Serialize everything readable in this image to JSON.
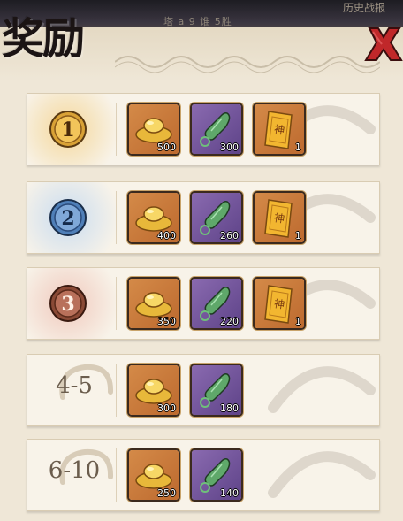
{
  "header": {
    "title": "奖励",
    "background_text": "塔 a 9 谁 5胜",
    "corner_text": "历史战报"
  },
  "rows": [
    {
      "rank": "1",
      "medal_color": "#d9a236",
      "glow": "#f4d79a",
      "rewards": [
        {
          "type": "gold-ingot",
          "qty": "500"
        },
        {
          "type": "jade-token",
          "qty": "300"
        },
        {
          "type": "talisman-card",
          "qty": "1"
        }
      ]
    },
    {
      "rank": "2",
      "medal_color": "#4f7fb8",
      "glow": "#c9dcf0",
      "rewards": [
        {
          "type": "gold-ingot",
          "qty": "400"
        },
        {
          "type": "jade-token",
          "qty": "260"
        },
        {
          "type": "talisman-card",
          "qty": "1"
        }
      ]
    },
    {
      "rank": "3",
      "medal_color": "#8a4a36",
      "glow": "#f0c9bd",
      "rewards": [
        {
          "type": "gold-ingot",
          "qty": "350"
        },
        {
          "type": "jade-token",
          "qty": "220"
        },
        {
          "type": "talisman-card",
          "qty": "1"
        }
      ]
    },
    {
      "rank": "4-5",
      "rewards": [
        {
          "type": "gold-ingot",
          "qty": "300"
        },
        {
          "type": "jade-token",
          "qty": "180"
        }
      ]
    },
    {
      "rank": "6-10",
      "rewards": [
        {
          "type": "gold-ingot",
          "qty": "250"
        },
        {
          "type": "jade-token",
          "qty": "140"
        }
      ]
    }
  ],
  "icons": {
    "close": "close-x-icon",
    "gold": "gold-ingot-icon",
    "jade": "jade-token-icon",
    "card": "talisman-card-icon"
  },
  "colors": {
    "parchment": "#efe7d7",
    "row_bg": "#f8f3e9",
    "close_red": "#c0282a"
  }
}
